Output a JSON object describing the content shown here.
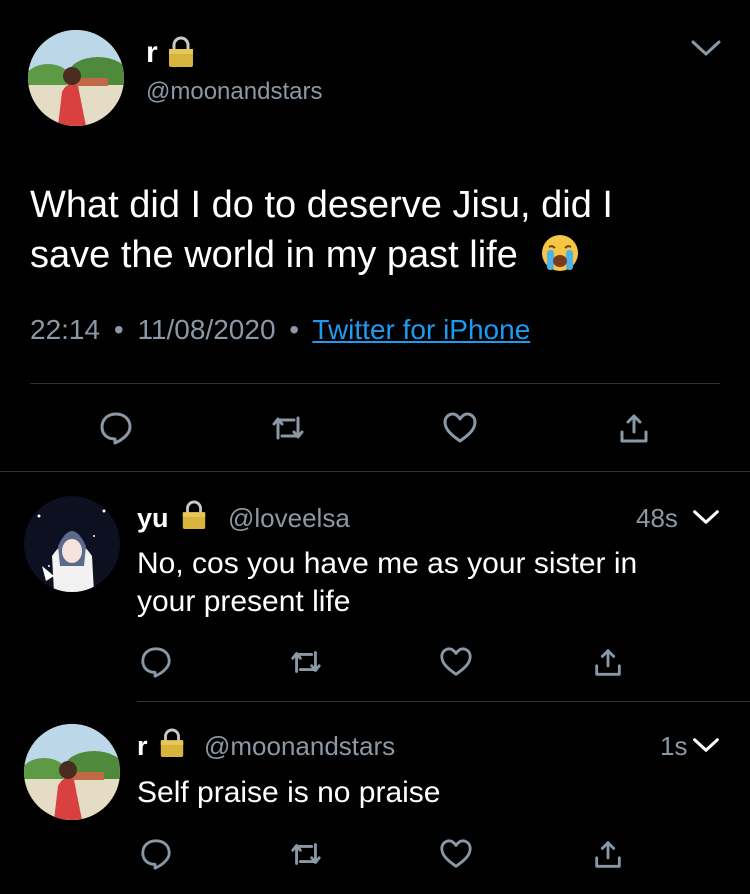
{
  "main_tweet": {
    "display_name": "r",
    "handle": "@moonandstars",
    "text_line1": "What did I do to deserve Jisu, did I",
    "text_line2": "save the world in my past life",
    "emoji": "😭",
    "time": "22:14",
    "sep1": "•",
    "date": "11/08/2020",
    "sep2": "•",
    "source": "Twitter for iPhone"
  },
  "replies": [
    {
      "display_name": "yu",
      "handle": "@loveelsa",
      "age": "48s",
      "text_line1": "No, cos you have me as your sister in",
      "text_line2": "your present life"
    },
    {
      "display_name": "r",
      "handle": "@moonandstars",
      "age": "1s",
      "text_line1": "Self praise is no praise"
    }
  ],
  "colors": {
    "background": "#000000",
    "text": "#ffffff",
    "secondary": "#8b98a5",
    "link": "#1d9bf0",
    "divider": "#2f3336"
  }
}
